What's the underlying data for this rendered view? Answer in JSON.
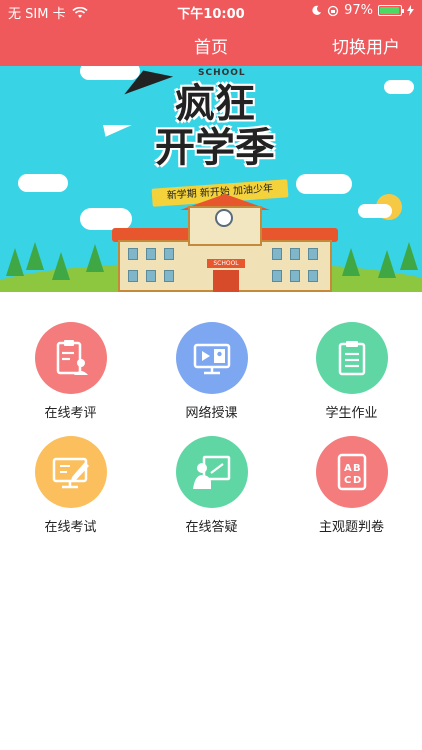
{
  "status_bar": {
    "carrier": "无 SIM 卡",
    "time": "下午10:00",
    "battery_percent": "97%",
    "battery_level": 0.97
  },
  "nav": {
    "title": "首页",
    "switch_user": "切换用户"
  },
  "banner": {
    "school_tag": "SCHOOL",
    "headline_line1": "疯狂",
    "headline_line2": "开学季",
    "ribbon_text": "新学期 新开始 加油少年",
    "building_sign": "SCHOOL"
  },
  "features": [
    {
      "label": "在线考评",
      "icon": "evaluation-clipboard-icon",
      "color": "#f47c7c"
    },
    {
      "label": "网络授课",
      "icon": "online-teaching-screen-icon",
      "color": "#7ea7f2"
    },
    {
      "label": "学生作业",
      "icon": "homework-clipboard-icon",
      "color": "#5fd6a4"
    },
    {
      "label": "在线考试",
      "icon": "exam-pencil-monitor-icon",
      "color": "#fbbf5d"
    },
    {
      "label": "在线答疑",
      "icon": "qa-teacher-board-icon",
      "color": "#5fd6a4"
    },
    {
      "label": "主观题判卷",
      "icon": "abcd-answer-sheet-icon",
      "color": "#f47c7c"
    }
  ],
  "colors": {
    "nav_bg": "#f0595c",
    "banner_bg": "#39d3e6"
  }
}
